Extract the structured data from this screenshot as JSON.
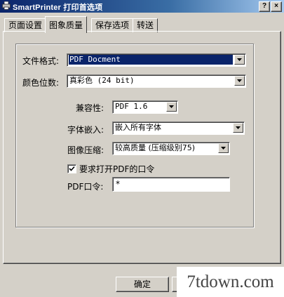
{
  "window": {
    "title": "SmartPrinter 打印首选项",
    "help_label": "?",
    "close_label": "×"
  },
  "tabs": [
    {
      "label": "页面设置",
      "active": false
    },
    {
      "label": "图象质量",
      "active": true
    },
    {
      "label": "保存选项",
      "active": false
    },
    {
      "label": "转送",
      "active": false
    }
  ],
  "form": {
    "file_format": {
      "label": "文件格式:",
      "value": "PDF Docment"
    },
    "color_depth": {
      "label": "颜色位数:",
      "value": "真彩色 (24 bit)"
    },
    "compatibility": {
      "label": "兼容性:",
      "value": "PDF 1.6"
    },
    "font_embed": {
      "label": "字体嵌入:",
      "value": "嵌入所有字体"
    },
    "image_compression": {
      "label": "图像压缩:",
      "value": "较高质量 (压缩级别75)"
    },
    "require_password": {
      "label": "要求打开PDF的口令",
      "checked": true
    },
    "pdf_password": {
      "label": "PDF口令:",
      "value": "*"
    }
  },
  "footer": {
    "ok_label": "确定"
  },
  "watermark": "7tdown.com"
}
